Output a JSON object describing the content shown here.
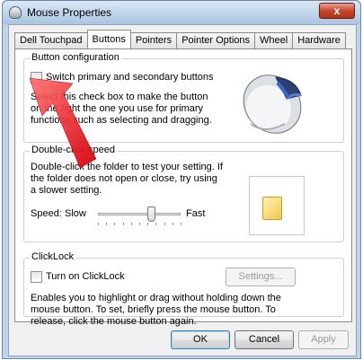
{
  "window": {
    "title": "Mouse Properties",
    "close_glyph": "x"
  },
  "tabs": [
    "Dell Touchpad",
    "Buttons",
    "Pointers",
    "Pointer Options",
    "Wheel",
    "Hardware"
  ],
  "active_tab": "Buttons",
  "button_config": {
    "title": "Button configuration",
    "checkbox_label": "Switch primary and secondary buttons",
    "checkbox_checked": false,
    "description": "Select this check box to make the button on the right the one you use for primary functions such as selecting and dragging."
  },
  "double_click": {
    "title": "Double-click speed",
    "description": "Double-click the folder to test your setting. If the folder does not open or close, try using a slower setting.",
    "speed_label": "Speed:",
    "slow_label": "Slow",
    "fast_label": "Fast",
    "speed_value_fraction": 0.65
  },
  "clicklock": {
    "title": "ClickLock",
    "checkbox_label": "Turn on ClickLock",
    "checkbox_checked": false,
    "settings_button": "Settings...",
    "description": "Enables you to highlight or drag without holding down the mouse button. To set, briefly press the mouse button. To release, click the mouse button again."
  },
  "footer": {
    "ok": "OK",
    "cancel": "Cancel",
    "apply": "Apply"
  },
  "icons": {
    "annotation": "red-arrow-icon",
    "mouse": "mouse-icon",
    "folder": "folder-icon"
  },
  "colors": {
    "annotation_arrow": "#e8141b",
    "chrome": "#bfd4e9"
  }
}
